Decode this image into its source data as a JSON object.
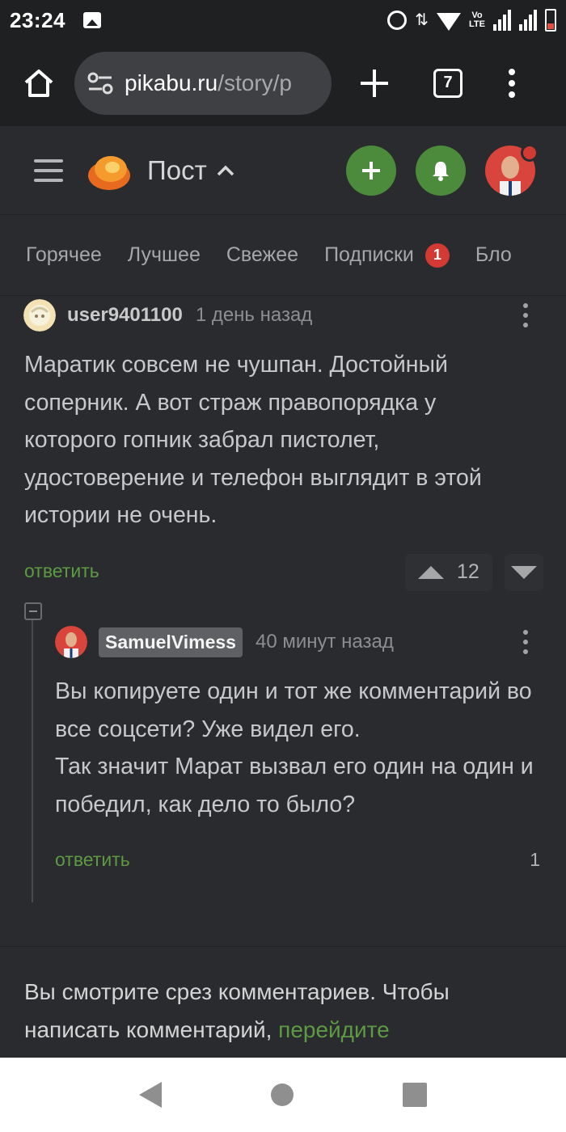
{
  "status_bar": {
    "time": "23:24",
    "network_label_top": "Vo",
    "network_label_bottom": "LTE"
  },
  "browser": {
    "url_host": "pikabu.ru",
    "url_path": "/story/p",
    "tab_count": "7"
  },
  "header": {
    "title": "Пост"
  },
  "tabs": [
    {
      "label": "Горячее"
    },
    {
      "label": "Лучшее"
    },
    {
      "label": "Свежее"
    },
    {
      "label": "Подписки",
      "badge": "1"
    },
    {
      "label": "Бло"
    }
  ],
  "comments": [
    {
      "user": "user9401100",
      "time": "1 день назад",
      "text": "Маратик совсем не чушпан. Достойный соперник. А вот страж правопорядка у которого гопник забрал пистолет, удостоверение и телефон выглядит в этой истории не очень.",
      "reply_label": "ответить",
      "rating": "12"
    },
    {
      "user": "SamuelVimess",
      "time": "40 минут назад",
      "text_line1": "Вы копируете один и тот же комментарий во все соцсети? Уже видел его.",
      "text_line2": "Так значит Марат вызвал его один на один и победил, как дело то было?",
      "reply_label": "ответить",
      "rating": "1"
    }
  ],
  "notice": {
    "text": "Вы смотрите срез комментариев. Чтобы написать комментарий, ",
    "link": "перейдите"
  },
  "colors": {
    "background": "#2a2b2e",
    "accent_green": "#4c8a3c",
    "link_green": "#5e9a43",
    "badge_red": "#d33a34"
  }
}
